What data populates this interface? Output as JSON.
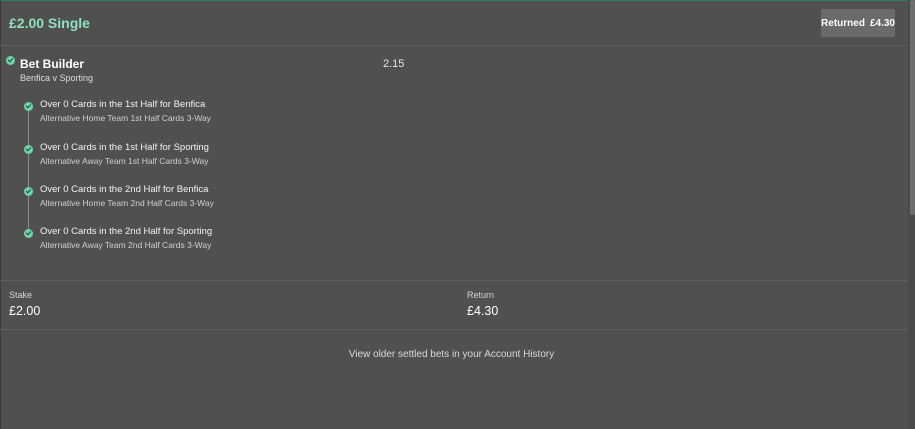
{
  "bet": {
    "title": "£2.00 Single",
    "returned_label": "Returned",
    "returned_value": "£4.30"
  },
  "bet_builder": {
    "title": "Bet Builder",
    "odds": "2.15",
    "event": "Benfica v Sporting",
    "legs": [
      {
        "selection": "Over 0 Cards in the 1st Half for Benfica",
        "market": "Alternative Home Team 1st Half Cards 3-Way"
      },
      {
        "selection": "Over 0 Cards in the 1st Half for Sporting",
        "market": "Alternative Away Team 1st Half Cards 3-Way"
      },
      {
        "selection": "Over 0 Cards in the 2nd Half for Benfica",
        "market": "Alternative Home Team 2nd Half Cards 3-Way"
      },
      {
        "selection": "Over 0 Cards in the 2nd Half for Sporting",
        "market": "Alternative Away Team 2nd Half Cards 3-Way"
      }
    ]
  },
  "summary": {
    "stake_label": "Stake",
    "stake_value": "£2.00",
    "return_label": "Return",
    "return_value": "£4.30"
  },
  "footer": {
    "history_link": "View older settled bets in your Account History"
  },
  "colors": {
    "background": "#505050",
    "accent_green": "#6fd3a8",
    "title_green": "#8fe0bf"
  },
  "icons": [
    "check-circle-icon"
  ]
}
